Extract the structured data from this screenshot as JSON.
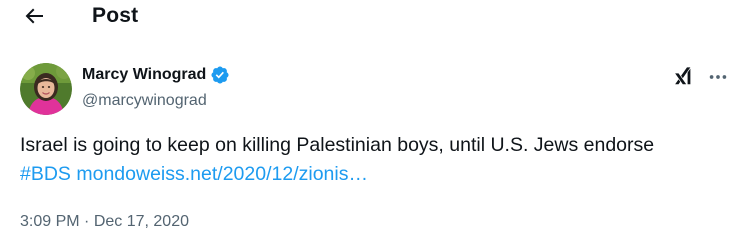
{
  "header": {
    "back_icon": "arrow-left-icon",
    "title": "Post"
  },
  "author": {
    "display_name": "Marcy Winograd",
    "handle": "@marcywinograd",
    "verified_icon": "verified-badge-icon",
    "verified_color": "#1d9bf0"
  },
  "actions": {
    "grok_icon": "grok-icon",
    "more_icon": "more-horizontal-icon"
  },
  "tweet": {
    "text": "Israel is going to keep on killing Palestinian boys, until U.S. Jews endorse",
    "hashtag": "#BDS",
    "link": "mondoweiss.net/2020/12/zionis…"
  },
  "meta": {
    "time": "3:09 PM",
    "separator": " · ",
    "date": "Dec 17, 2020"
  },
  "colors": {
    "text_primary": "#0f1419",
    "text_secondary": "#536471",
    "link": "#1d9bf0",
    "background": "#ffffff"
  }
}
